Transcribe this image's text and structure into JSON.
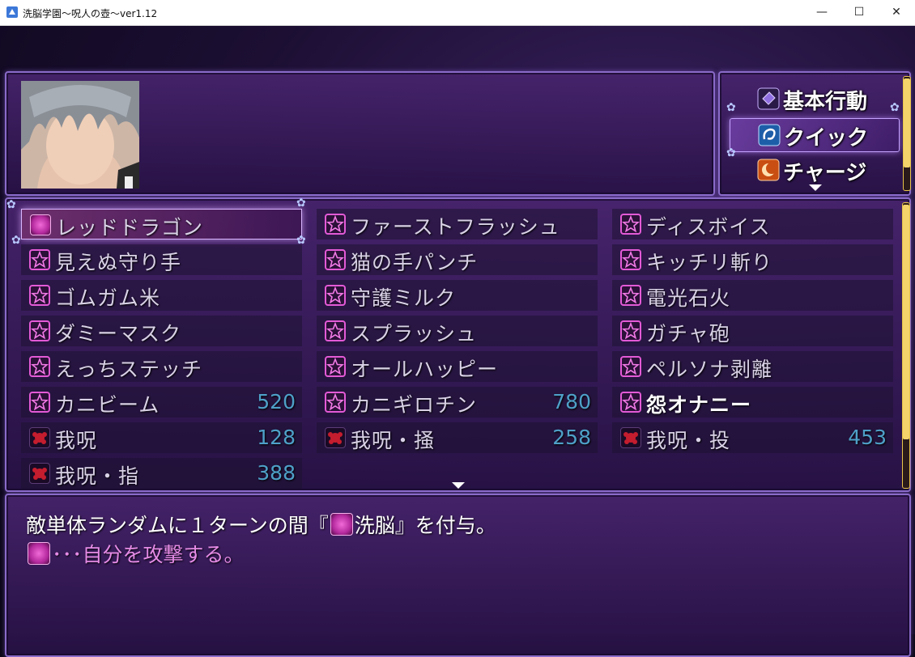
{
  "window": {
    "title": "洗脳学園～呪人の壺～ver1.12",
    "minimize_glyph": "—",
    "maximize_glyph": "☐",
    "close_glyph": "✕"
  },
  "commands": [
    {
      "label": "基本行動",
      "icon": "book-icon",
      "selected": false
    },
    {
      "label": "クイック",
      "icon": "swirl-icon",
      "selected": true
    },
    {
      "label": "チャージ",
      "icon": "crescent-icon",
      "selected": false
    }
  ],
  "skills": {
    "col1": [
      {
        "name": "レッドドラゴン",
        "icon": "brain-icon",
        "cost": "",
        "selected": true
      },
      {
        "name": "見えぬ守り手",
        "icon": "star-icon",
        "cost": ""
      },
      {
        "name": "ゴムガム米",
        "icon": "star-icon",
        "cost": ""
      },
      {
        "name": "ダミーマスク",
        "icon": "star-icon",
        "cost": ""
      },
      {
        "name": "えっちステッチ",
        "icon": "star-icon",
        "cost": ""
      },
      {
        "name": "カニビーム",
        "icon": "star-icon",
        "cost": "520"
      },
      {
        "name": "我呪",
        "icon": "curse-icon",
        "cost": "128"
      },
      {
        "name": "我呪・指",
        "icon": "curse-icon",
        "cost": "388"
      }
    ],
    "col2": [
      {
        "name": "ファーストフラッシュ",
        "icon": "star-icon",
        "cost": ""
      },
      {
        "name": "猫の手パンチ",
        "icon": "star-icon",
        "cost": ""
      },
      {
        "name": "守護ミルク",
        "icon": "star-icon",
        "cost": ""
      },
      {
        "name": "スプラッシュ",
        "icon": "star-icon",
        "cost": ""
      },
      {
        "name": "オールハッピー",
        "icon": "star-icon",
        "cost": ""
      },
      {
        "name": "カニギロチン",
        "icon": "star-icon",
        "cost": "780"
      },
      {
        "name": "我呪・掻",
        "icon": "curse-icon",
        "cost": "258"
      }
    ],
    "col3": [
      {
        "name": "ディスボイス",
        "icon": "star-icon",
        "cost": ""
      },
      {
        "name": "キッチリ斬り",
        "icon": "star-icon",
        "cost": ""
      },
      {
        "name": "電光石火",
        "icon": "star-icon",
        "cost": ""
      },
      {
        "name": "ガチャ砲",
        "icon": "star-icon",
        "cost": ""
      },
      {
        "name": "ペルソナ剥離",
        "icon": "star-icon",
        "cost": ""
      },
      {
        "name": "怨オナニー",
        "icon": "star-icon",
        "cost": "",
        "bright": true
      },
      {
        "name": "我呪・投",
        "icon": "curse-icon",
        "cost": "453"
      }
    ]
  },
  "help": {
    "line1_pre": "敵単体ランダムに１ターンの間『",
    "line1_post": "洗脳』を付与。",
    "line2": "･･･自分を攻撃する。"
  },
  "colors": {
    "panel_border": "#8a6bc9",
    "cost_blue": "#4ea0c8",
    "help_pink": "#e58be6",
    "star_pink": "#e35ad6"
  }
}
